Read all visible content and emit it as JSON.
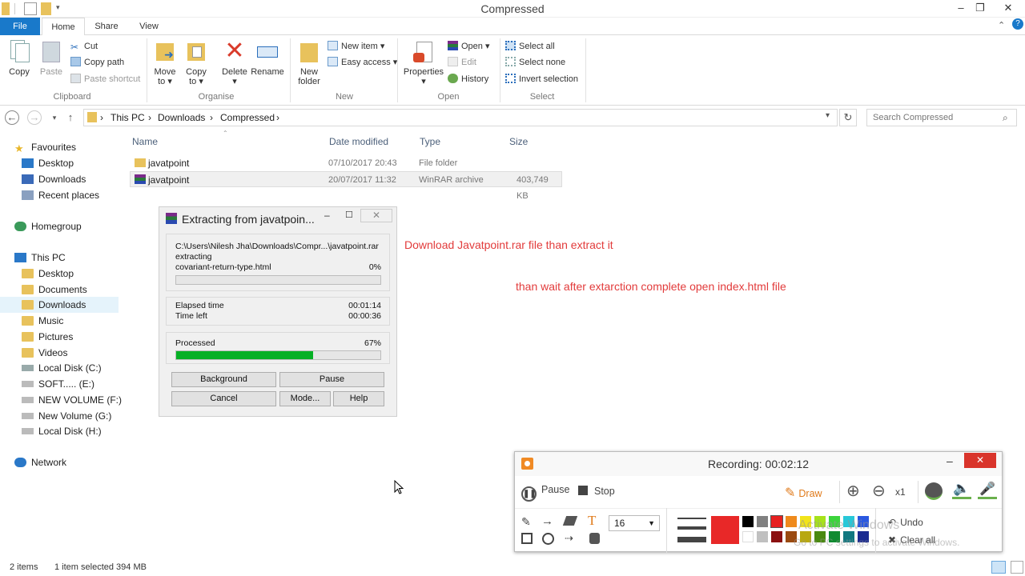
{
  "window": {
    "title": "Compressed",
    "minimize": "–",
    "restore": "❐",
    "close": "✕"
  },
  "ribbon_tabs": {
    "file": "File",
    "home": "Home",
    "share": "Share",
    "view": "View"
  },
  "ribbon": {
    "clipboard": {
      "label": "Clipboard",
      "copy": "Copy",
      "paste": "Paste",
      "cut": "Cut",
      "copy_path": "Copy path",
      "paste_shortcut": "Paste shortcut"
    },
    "organise": {
      "label": "Organise",
      "move_to": "Move",
      "move_to_2": "to ▾",
      "copy_to": "Copy",
      "copy_to_2": "to ▾",
      "delete": "Delete",
      "delete_2": "▾",
      "rename": "Rename"
    },
    "new": {
      "label": "New",
      "new_folder": "New",
      "new_folder_2": "folder",
      "new_item": "New item ▾",
      "easy_access": "Easy access ▾"
    },
    "open": {
      "label": "Open",
      "properties": "Properties",
      "properties_2": "▾",
      "open": "Open ▾",
      "edit": "Edit",
      "history": "History"
    },
    "select": {
      "label": "Select",
      "select_all": "Select all",
      "select_none": "Select none",
      "invert": "Invert selection"
    },
    "collapse": "⌃",
    "help": "?"
  },
  "address": {
    "this_pc": "This PC",
    "downloads": "Downloads",
    "compressed": "Compressed",
    "sep": "›",
    "search_placeholder": "Search Compressed"
  },
  "nav": {
    "favourites": "Favourites",
    "desktop": "Desktop",
    "downloads": "Downloads",
    "recent": "Recent places",
    "homegroup": "Homegroup",
    "this_pc": "This PC",
    "pc_desktop": "Desktop",
    "documents": "Documents",
    "pc_downloads": "Downloads",
    "music": "Music",
    "pictures": "Pictures",
    "videos": "Videos",
    "local_c": "Local Disk (C:)",
    "soft_e": "SOFT..... (E:)",
    "new_volume_f": "NEW VOLUME (F:)",
    "new_volume_g": "New Volume (G:)",
    "local_h": "Local Disk (H:)",
    "network": "Network"
  },
  "columns": {
    "name": "Name",
    "date": "Date modified",
    "type": "Type",
    "size": "Size"
  },
  "files": [
    {
      "name": "javatpoint",
      "date": "07/10/2017 20:43",
      "type": "File folder",
      "size": ""
    },
    {
      "name": "javatpoint",
      "date": "20/07/2017 11:32",
      "type": "WinRAR archive",
      "size": "403,749 KB"
    }
  ],
  "dialog": {
    "title": "Extracting from javatpoin...",
    "path": "C:\\Users\\Nilesh Jha\\Downloads\\Compr...\\javatpoint.rar",
    "action": "extracting",
    "file": "covariant-return-type.html",
    "file_pct": "0%",
    "elapsed_label": "Elapsed time",
    "elapsed": "00:01:14",
    "left_label": "Time left",
    "left": "00:00:36",
    "processed_label": "Processed",
    "processed_pct": "67%",
    "processed_value": 0.67,
    "buttons": {
      "background": "Background",
      "pause": "Pause",
      "cancel": "Cancel",
      "mode": "Mode...",
      "help": "Help"
    }
  },
  "annotations": {
    "line1": "Download Javatpoint.rar  file than extract it",
    "line2": "than wait  after extarction complete open index.html file"
  },
  "recorder": {
    "status": "Recording:  00:02:12",
    "pause": "Pause",
    "stop": "Stop",
    "draw": "Draw",
    "zoom": "x1",
    "font_size": "16",
    "undo": "Undo",
    "clear_all": "Clear all",
    "colors": [
      "#000000",
      "#808080",
      "#e62020",
      "#ef8a1c",
      "#f2e41a",
      "#a6e21a",
      "#3cd43c",
      "#28c8d8",
      "#2a58e0",
      "#ffffff",
      "#c0c0c0",
      "#8b1010",
      "#9a4a10",
      "#b8a810",
      "#4a8a10",
      "#108a30",
      "#107880",
      "#1a2a90"
    ],
    "selected_color": "#e82828",
    "watermark_1": "Activate Windows",
    "watermark_2": "Go to PC settings to activate Windows."
  },
  "statusbar": {
    "items": "2 items",
    "selected": "1 item selected  394 MB"
  }
}
